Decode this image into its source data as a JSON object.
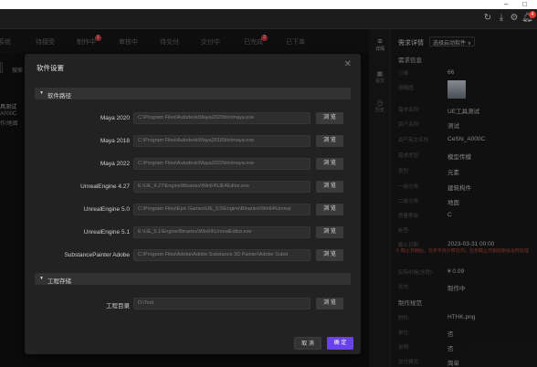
{
  "window": {
    "minimize": "–",
    "close": "□"
  },
  "topbar_icons": [
    "refresh-icon",
    "download-icon",
    "settings-icon",
    "bell-icon"
  ],
  "notification_count": "4",
  "tabs": [
    {
      "label": "系统"
    },
    {
      "label": "待接受"
    },
    {
      "label": "制作中",
      "badge": "1"
    },
    {
      "label": "审核中"
    },
    {
      "label": "待交付"
    },
    {
      "label": "交付中"
    },
    {
      "label": "已完成",
      "badge": "2"
    },
    {
      "label": "已下单"
    }
  ],
  "behind": {
    "search_label": "搜索",
    "item_title": "具测试",
    "item_line1": "A000C",
    "item_line2": "作/地面"
  },
  "right_nav": [
    {
      "icon": "≡",
      "label": "详情"
    },
    {
      "icon": "▣",
      "label": "提交"
    },
    {
      "icon": "◷",
      "label": "历史"
    }
  ],
  "right_panel": {
    "header_title": "需求详情",
    "select_value": "选择启动软件 ∨",
    "section_basic": "需求信息",
    "rows": [
      {
        "k": "订单:",
        "v": "66"
      },
      {
        "k": "缩略图:",
        "v": ""
      },
      {
        "k": "需求名称:",
        "v": "UE工具测试"
      },
      {
        "k": "资产名称:",
        "v": "测试"
      },
      {
        "k": "资产英文名称:",
        "v": "CeShi_A000C"
      },
      {
        "k": "需求类型:",
        "v": "模型传模"
      },
      {
        "k": "类型:",
        "v": "元素"
      },
      {
        "k": "一级分类:",
        "v": "建筑构件"
      },
      {
        "k": "二级分类:",
        "v": "地面"
      },
      {
        "k": "质量等级:",
        "v": "C"
      },
      {
        "k": "标签:",
        "v": ""
      },
      {
        "k": "截止日期:",
        "v": "2023-03-31 00:00"
      }
    ],
    "warning": "① 截止日期后，任务不再计算在内；任务截止日期延期请及时处理",
    "rows2": [
      {
        "k": "实际价格(含税):",
        "v": "¥ 0.09"
      },
      {
        "k": "状态:",
        "v": "制作中"
      }
    ],
    "section_spec": "制作规范",
    "rows3": [
      {
        "k": "附件:",
        "v": "HTHK.png"
      },
      {
        "k": "单位:",
        "v": "否"
      },
      {
        "k": "说明:",
        "v": "否"
      },
      {
        "k": "交付模式:",
        "v": "简单"
      }
    ]
  },
  "modal": {
    "title": "软件设置",
    "close": "✕",
    "section_paths": "软件路径",
    "browse": "浏 览",
    "software": [
      {
        "label": "Maya 2020",
        "path": "C:\\Program Files\\Autodesk\\Maya2020\\bin\\maya.exe"
      },
      {
        "label": "Maya 2018",
        "path": "C:\\Program Files\\Autodesk\\Maya2018\\bin\\maya.exe"
      },
      {
        "label": "Maya 2022",
        "path": "C:\\Program Files\\Autodesk\\Maya2022\\bin\\maya.exe"
      },
      {
        "label": "UnrealEngine 4.27",
        "path": "E:\\UE_4.27\\Engine\\Binaries\\Win64\\UE4Editor.exe"
      },
      {
        "label": "UnrealEngine 5.0",
        "path": "C:\\Program Files\\Epic Games\\UE_5.0\\Engine\\Binaries\\Win64\\Unreal"
      },
      {
        "label": "UnrealEngine 5.1",
        "path": "E:\\UE_5.1\\Engine\\Binaries\\Win64\\UnrealEditor.exe"
      },
      {
        "label": "SubstancePainter Adobe",
        "path": "C:\\Program Files\\Adobe\\Adobe Substance 3D Painter\\Adobe Subst"
      }
    ],
    "section_storage": "工程存储",
    "project_dir_label": "工程目录",
    "project_dir_value": "D:\\Test",
    "cancel": "取 消",
    "confirm": "确 定"
  },
  "colors": {
    "accent": "#6a43e8",
    "danger": "#e3342f",
    "warning": "#c74a3a"
  }
}
